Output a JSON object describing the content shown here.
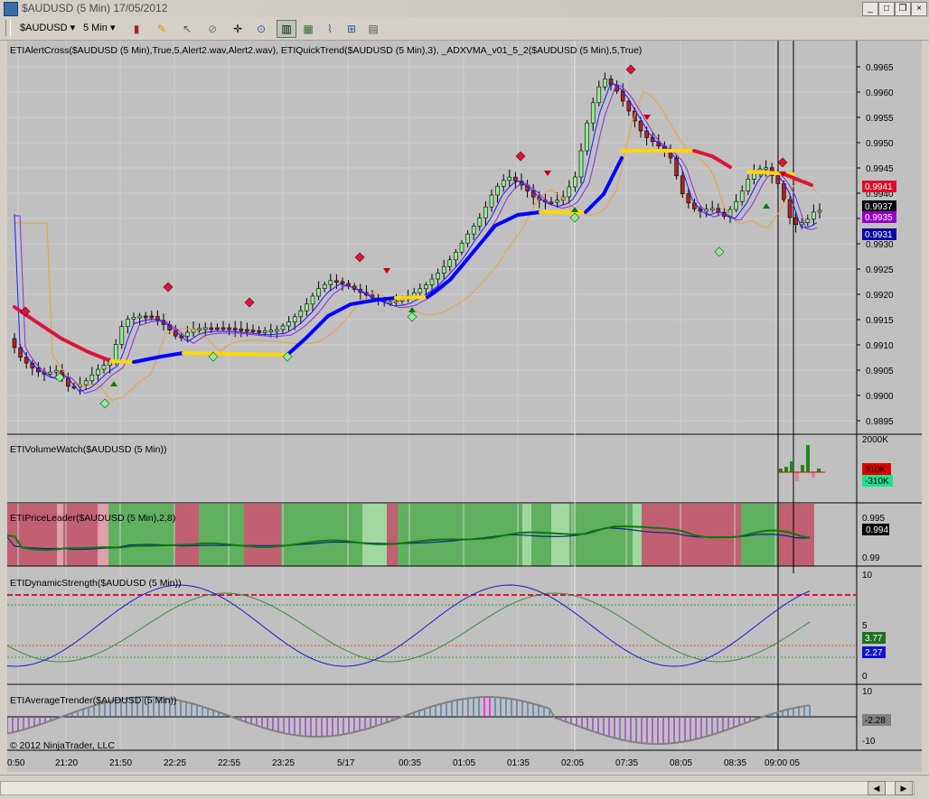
{
  "window": {
    "title": "$AUDUSD (5 Min)  17/05/2012"
  },
  "toolbar": {
    "instrument": "$AUDUSD",
    "interval": "5 Min"
  },
  "panels": {
    "price_label": "ETIAlertCross($AUDUSD (5 Min),True,5,Alert2.wav,Alert2.wav), ETIQuickTrend($AUDUSD (5 Min),3), _ADXVMA_v01_5_2($AUDUSD (5 Min),5,True)",
    "volume_label": "ETIVolumeWatch($AUDUSD (5 Min))",
    "leader_label": "ETIPriceLeader($AUDUSD (5 Min),2,8)",
    "strength_label": "ETIDynamicStrength($AUDUSD (5 Min))",
    "trender_label": "ETIAverageTrender($AUDUSD (5 Min))",
    "copyright": "© 2012 NinjaTrader, LLC"
  },
  "price_axis": [
    "0.9965",
    "0.9960",
    "0.9955",
    "0.9950",
    "0.9945",
    "0.9940",
    "0.9935",
    "0.9930",
    "0.9925",
    "0.9920",
    "0.9915",
    "0.9910",
    "0.9905",
    "0.9900",
    "0.9895"
  ],
  "price_badges": [
    "0.9941",
    "0.9937",
    "0.9935",
    "0.9931"
  ],
  "volume_axis": [
    "2000K"
  ],
  "volume_badges": [
    "310K",
    "-310K"
  ],
  "leader_axis": [
    "0.995",
    "0.99"
  ],
  "leader_badge": "0.994",
  "strength_axis": [
    "10",
    "5",
    "0"
  ],
  "strength_badges": [
    "3.77",
    "2.27"
  ],
  "trender_axis": [
    "10",
    "-10"
  ],
  "trender_badge": "-2.28",
  "time_axis": [
    "0:50",
    "21:20",
    "21:50",
    "22:25",
    "22:55",
    "23:25",
    "5/17",
    "00:35",
    "01:05",
    "01:35",
    "02:05",
    "07:35",
    "08:05",
    "08:35",
    "09:00 05"
  ],
  "colors": {
    "bull": "#90ee90",
    "bear": "#b22222",
    "trend_up": "#0000ff",
    "trend_down": "#dc143c",
    "flat": "#ffd700",
    "bg": "#c0c0c0"
  }
}
